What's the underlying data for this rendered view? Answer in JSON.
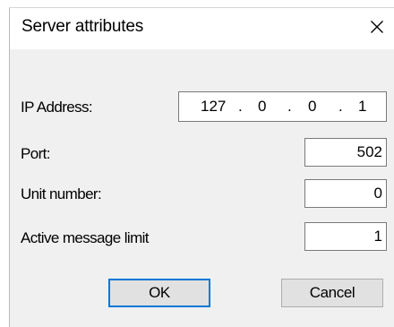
{
  "dialog": {
    "title": "Server attributes",
    "close_icon": "close-icon"
  },
  "fields": {
    "ip_address": {
      "label": "IP Address:",
      "octets": [
        "127",
        "0",
        "0",
        "1"
      ],
      "separator": "."
    },
    "port": {
      "label": "Port:",
      "value": "502"
    },
    "unit_number": {
      "label": "Unit number:",
      "value": "0"
    },
    "active_message_limit": {
      "label": "Active message limit",
      "value": "1"
    }
  },
  "buttons": {
    "ok_label": "OK",
    "cancel_label": "Cancel"
  },
  "colors": {
    "focus_border": "#0078d7",
    "body_background": "#f0f0f0",
    "button_background": "#e1e1e1"
  }
}
